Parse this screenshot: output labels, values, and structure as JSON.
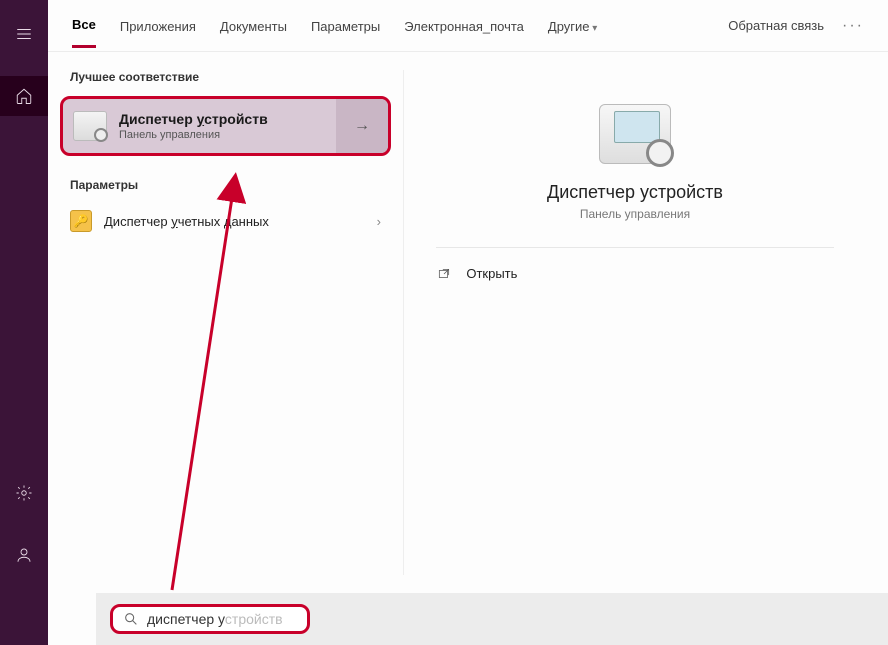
{
  "sidebar": {
    "icons": [
      "hamburger",
      "home",
      "gear",
      "person"
    ]
  },
  "tabs": {
    "items": [
      {
        "label": "Все",
        "active": true
      },
      {
        "label": "Приложения"
      },
      {
        "label": "Документы"
      },
      {
        "label": "Параметры"
      },
      {
        "label": "Электронная_почта"
      },
      {
        "label": "Другие",
        "dropdown": true
      }
    ],
    "feedback": "Обратная связь"
  },
  "left": {
    "best_match_label": "Лучшее соответствие",
    "best_match": {
      "title_pre": "Диспетчер ",
      "title_ul": "у",
      "title_post": "стройств",
      "subtitle": "Панель управления"
    },
    "params_label": "Параметры",
    "params": [
      {
        "pre": "Диспетчер ",
        "ul": "у",
        "post": "четных данных"
      }
    ]
  },
  "detail": {
    "title": "Диспетчер устройств",
    "subtitle": "Панель управления",
    "open_label": "Открыть"
  },
  "search": {
    "typed": "диспетчер у",
    "suggestion": "стройств"
  }
}
